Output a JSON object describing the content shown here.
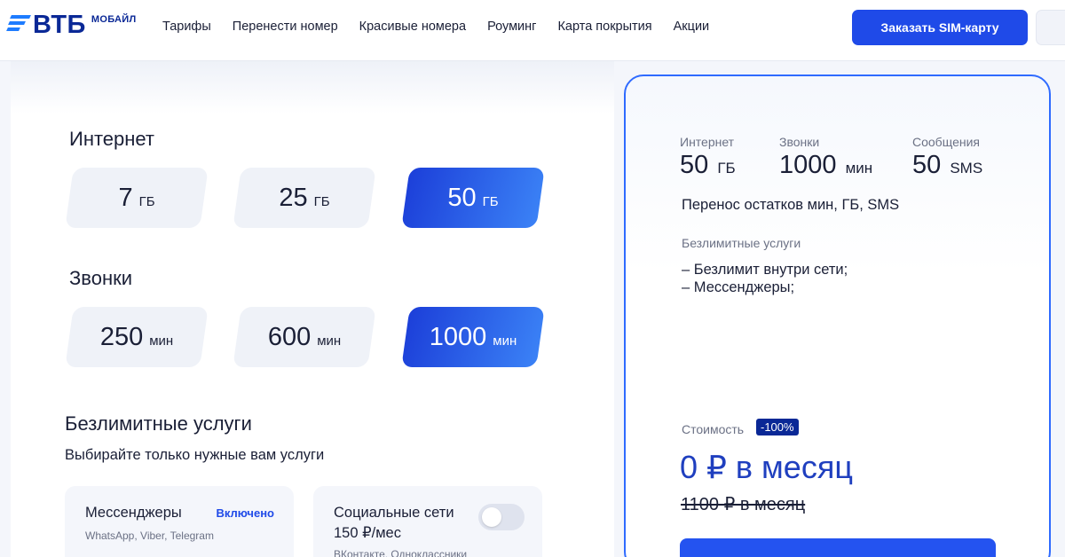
{
  "header": {
    "logo_text": "ВТБ",
    "logo_sub": "МОБАЙЛ",
    "nav": [
      "Тарифы",
      "Перенести номер",
      "Красивые номера",
      "Роуминг",
      "Карта покрытия",
      "Акции"
    ],
    "order_button": "Заказать SIM-карту"
  },
  "internet": {
    "title": "Интернет",
    "options": [
      {
        "value": "7",
        "unit": "ГБ",
        "selected": false
      },
      {
        "value": "25",
        "unit": "ГБ",
        "selected": false
      },
      {
        "value": "50",
        "unit": "ГБ",
        "selected": true
      }
    ]
  },
  "calls": {
    "title": "Звонки",
    "options": [
      {
        "value": "250",
        "unit": "мин",
        "selected": false
      },
      {
        "value": "600",
        "unit": "мин",
        "selected": false
      },
      {
        "value": "1000",
        "unit": "мин",
        "selected": true
      }
    ]
  },
  "unlimited": {
    "title": "Безлимитные услуги",
    "subtitle": "Выбирайте только нужные вам услуги",
    "services": [
      {
        "name": "Мессенджеры",
        "status": "Включено",
        "description": "WhatsApp, Viber, Telegram"
      },
      {
        "name": "Социальные сети",
        "price": "150 ₽/мес",
        "description": "ВКонтакте, Одноклассники",
        "enabled": false
      }
    ]
  },
  "summary": {
    "stats": [
      {
        "label": "Интернет",
        "value": "50",
        "unit": "ГБ"
      },
      {
        "label": "Звонки",
        "value": "1000",
        "unit": "мин"
      },
      {
        "label": "Сообщения",
        "value": "50",
        "unit": "SMS"
      }
    ],
    "carryover": "Перенос остатков мин, ГБ, SMS",
    "unlimited_label": "Безлимитные услуги",
    "unlimited_items": [
      "– Безлимит внутри сети;",
      "– Мессенджеры;"
    ],
    "cost_label": "Стоимость",
    "discount_badge": "-100%",
    "price": "0 ₽ в месяц",
    "old_price": "1100 ₽ в месяц"
  },
  "colors": {
    "brand": "#0a2896",
    "accent": "#1f4ae8",
    "selected_gradient_start": "#1c3fd9",
    "selected_gradient_end": "#3b82f6"
  }
}
